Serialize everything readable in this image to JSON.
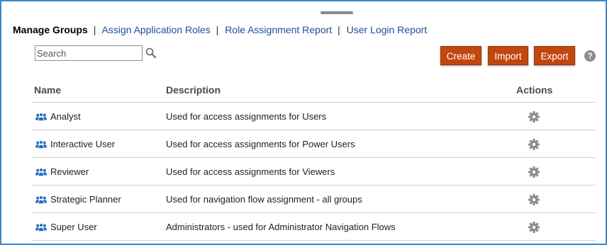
{
  "nav": {
    "current": "Manage Groups",
    "links": [
      "Assign Application Roles",
      "Role Assignment Report",
      "User Login Report"
    ],
    "separator": "|"
  },
  "search": {
    "placeholder": "Search",
    "value": "",
    "icon": "magnifier-icon"
  },
  "actions": {
    "create_label": "Create",
    "import_label": "Import",
    "export_label": "Export",
    "help_label": "?",
    "button_color": "#c2470e"
  },
  "table": {
    "headers": {
      "name": "Name",
      "description": "Description",
      "actions": "Actions"
    },
    "rows": [
      {
        "name": "Analyst",
        "description": "Used for access assignments for Users"
      },
      {
        "name": "Interactive User",
        "description": "Used for access assignments for Power Users"
      },
      {
        "name": "Reviewer",
        "description": "Used for access assignments for Viewers"
      },
      {
        "name": "Strategic Planner",
        "description": "Used for navigation flow assignment - all groups"
      },
      {
        "name": "Super User",
        "description": "Administrators - used for Administrator Navigation Flows"
      }
    ],
    "row_icon": "group-icon",
    "action_icon": "gear-icon"
  },
  "colors": {
    "frame_border": "#3d87c8",
    "link": "#1b4f9c",
    "group_icon": "#1f6fbf"
  }
}
